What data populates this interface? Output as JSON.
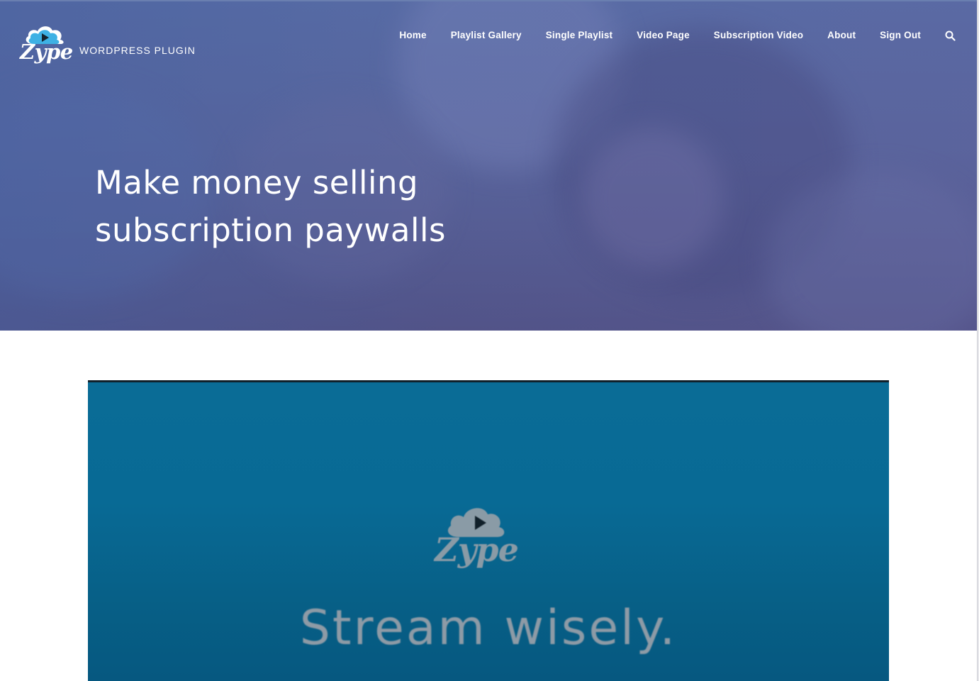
{
  "site": {
    "logo_text": "Zype",
    "tagline": "WORDPRESS PLUGIN"
  },
  "nav": {
    "items": [
      {
        "label": "Home"
      },
      {
        "label": "Playlist Gallery"
      },
      {
        "label": "Single Playlist"
      },
      {
        "label": "Video Page"
      },
      {
        "label": "Subscription Video"
      },
      {
        "label": "About"
      },
      {
        "label": "Sign Out"
      }
    ],
    "search_icon": "search-icon"
  },
  "hero": {
    "title": "Make money selling subscription paywalls"
  },
  "video": {
    "logo_text": "Zype",
    "tagline": "Stream wisely.",
    "colors": {
      "background": "#086a95",
      "text": "#8e9ba6"
    }
  },
  "colors": {
    "hero_tint": "#5b669b",
    "nav_text": "#ffffff",
    "logo_cloud_blue": "#29a9e1"
  }
}
